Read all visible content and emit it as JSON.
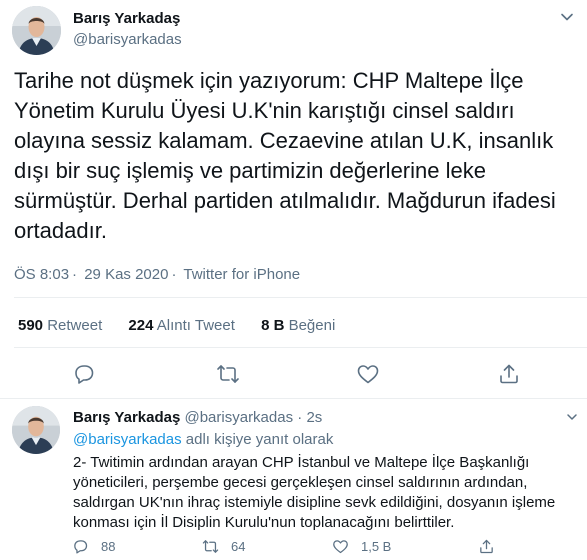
{
  "tweet": {
    "author_name": "Barış Yarkadaş",
    "author_handle": "@barisyarkadas",
    "text": "Tarihe not düşmek için yazıyorum: CHP Maltepe İlçe Yönetim Kurulu Üyesi U.K'nin karıştığı cinsel saldırı olayına sessiz kalamam. Cezaevine atılan U.K, insanlık dışı bir suç işlemiş ve partimizin değerlerine leke sürmüştür. Derhal partiden atılmalıdır. Mağdurun ifadesi ortadadır.",
    "time": "ÖS 8:03",
    "date": "29 Kas 2020",
    "source": "Twitter for iPhone",
    "separator": "·",
    "stats": {
      "retweets": "590",
      "retweets_label": "Retweet",
      "quotes": "224",
      "quotes_label": "Alıntı Tweet",
      "likes": "8 B",
      "likes_label": "Beğeni"
    }
  },
  "reply": {
    "author_name": "Barış Yarkadaş",
    "author_handle": "@barisyarkadas",
    "separator": "·",
    "age": "2s",
    "reply_to_handle": "@barisyarkadas",
    "reply_to_suffix": " adlı kişiye yanıt olarak",
    "text": "2- Twitimin ardından arayan CHP İstanbul ve Maltepe İlçe Başkanlığı yöneticileri, perşembe gecesi gerçekleşen cinsel saldırının ardından, saldırgan UK'nın ihraç istemiyle disipline sevk edildiğini, dosyanın işleme konması için İl Disiplin Kurulu'nun toplanacağını belirttiler.",
    "replies": "88",
    "retweets": "64",
    "likes": "1,5 B"
  },
  "colors": {
    "text_primary": "#0f1419",
    "text_secondary": "#5b7083",
    "link": "#1b95e0",
    "divider": "#ebeef0"
  },
  "icons": [
    "caret-down-icon",
    "reply-icon",
    "retweet-icon",
    "like-icon",
    "share-icon"
  ]
}
